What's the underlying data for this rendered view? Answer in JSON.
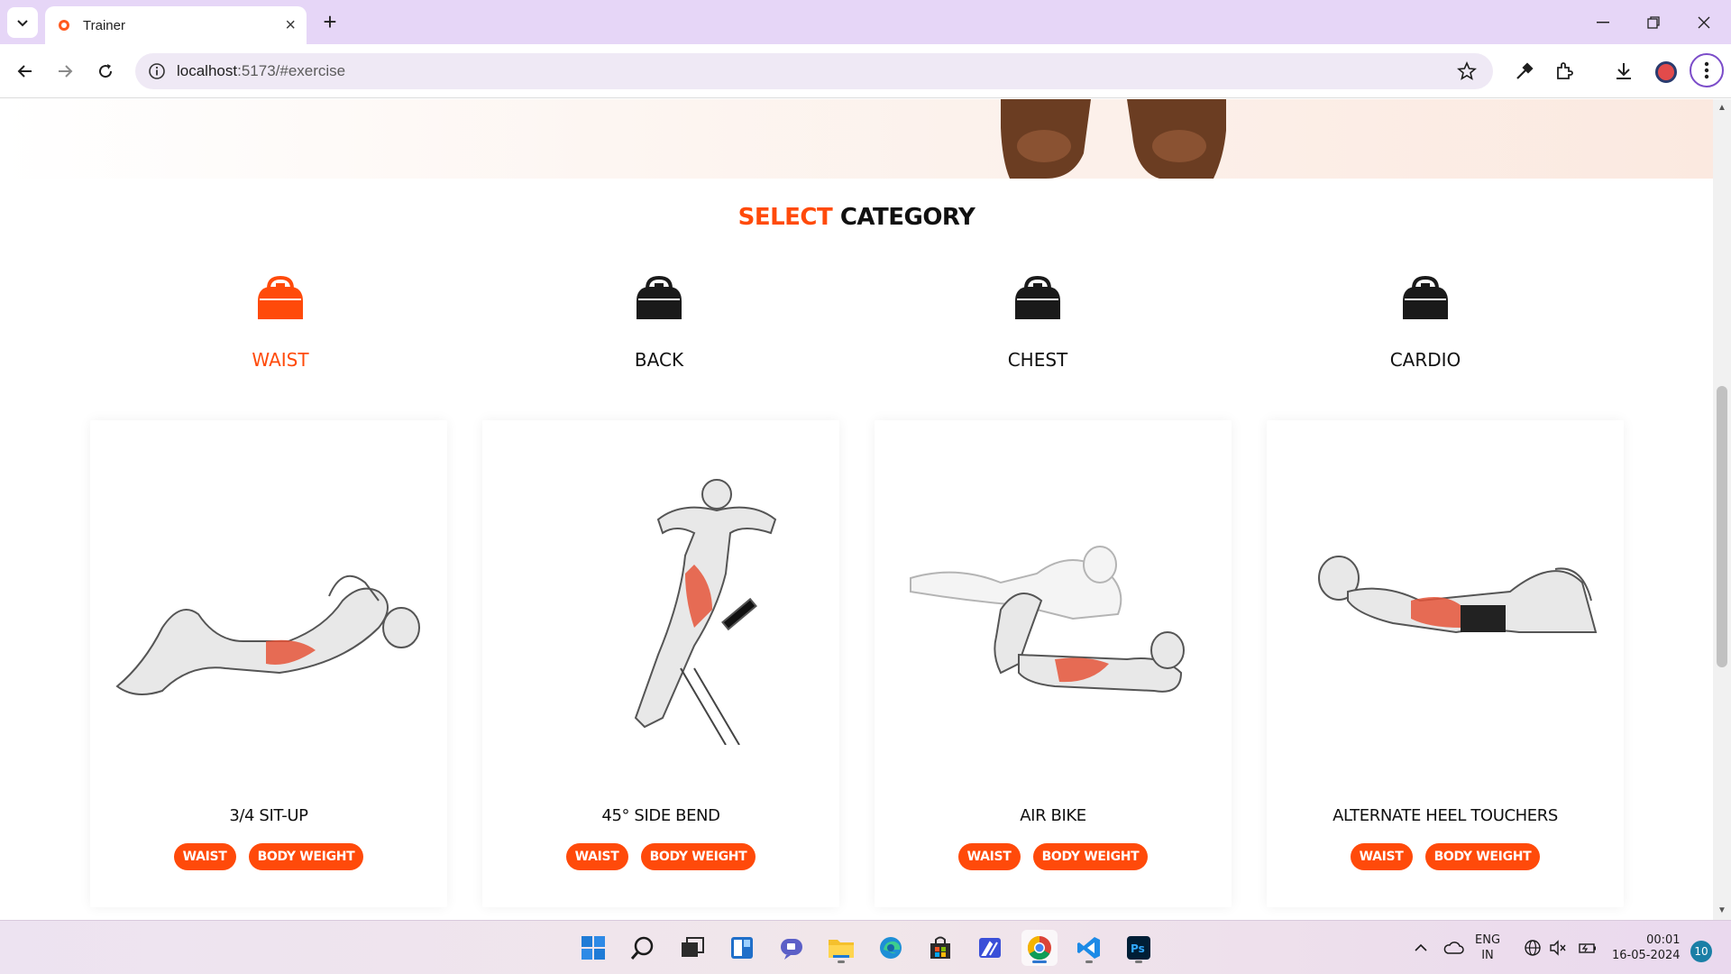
{
  "browser": {
    "tab_title": "Trainer",
    "url_host": "localhost",
    "url_path": ":5173/#exercise"
  },
  "page": {
    "section_title_accent": "SELECT",
    "section_title_rest": "CATEGORY",
    "categories": [
      {
        "label": "WAIST",
        "active": true
      },
      {
        "label": "BACK",
        "active": false
      },
      {
        "label": "CHEST",
        "active": false
      },
      {
        "label": "CARDIO",
        "active": false
      }
    ],
    "exercises": [
      {
        "name": "3/4 SIT-UP",
        "tags": [
          "WAIST",
          "BODY WEIGHT"
        ]
      },
      {
        "name": "45° SIDE BEND",
        "tags": [
          "WAIST",
          "BODY WEIGHT"
        ]
      },
      {
        "name": "AIR BIKE",
        "tags": [
          "WAIST",
          "BODY WEIGHT"
        ]
      },
      {
        "name": "ALTERNATE HEEL TOUCHERS",
        "tags": [
          "WAIST",
          "BODY WEIGHT"
        ]
      }
    ],
    "accent_color": "#ff4a0a"
  },
  "taskbar": {
    "lang_top": "ENG",
    "lang_bottom": "IN",
    "time": "00:01",
    "date": "16-05-2024",
    "notifications": "10",
    "apps": [
      "start-icon",
      "search-icon",
      "task-view-icon",
      "widgets-icon",
      "teams-icon",
      "file-explorer-icon",
      "edge-icon",
      "store-icon",
      "app-icon",
      "chrome-icon",
      "vscode-icon",
      "photoshop-icon"
    ]
  }
}
